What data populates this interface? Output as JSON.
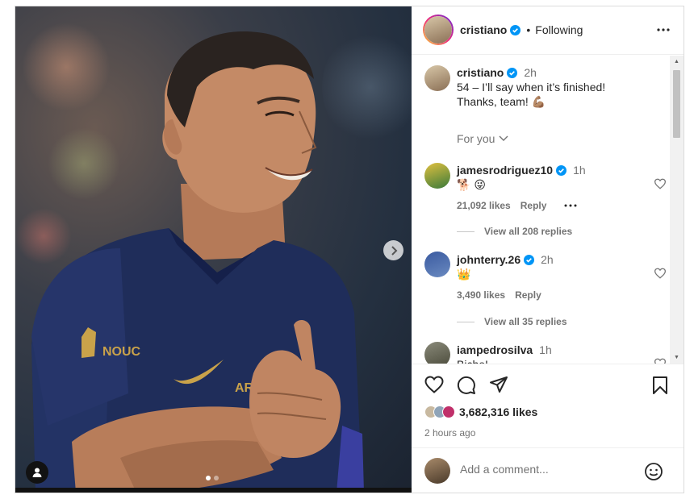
{
  "post": {
    "author": "cristiano",
    "follow_status": "Following",
    "separator": "•",
    "caption_line1": "54 – I’ll say when it’s finished!",
    "caption_line2": "Thanks, team! 💪🏽",
    "caption_time": "2h",
    "translation_label": "For you",
    "likes": "3,682,316 likes",
    "posted": "2 hours ago",
    "carousel": {
      "total": 2,
      "current": 1
    }
  },
  "comments": [
    {
      "user": "jamesrodriguez10",
      "verified": true,
      "time": "1h",
      "text": "🐕 😜",
      "likes": "21,092 likes",
      "reply": "Reply",
      "view_replies": "View all 208 replies"
    },
    {
      "user": "johnterry.26",
      "verified": true,
      "time": "2h",
      "text": "👑",
      "likes": "3,490 likes",
      "reply": "Reply",
      "view_replies": "View all 35 replies"
    },
    {
      "user": "iampedrosilva",
      "verified": false,
      "time": "1h",
      "text": "Bicho!"
    }
  ],
  "comment_box": {
    "placeholder": "Add a comment..."
  },
  "colors": {
    "verified": "#0095f6",
    "text": "#262626",
    "muted": "#737373",
    "border": "#dbdbdb"
  },
  "icons": [
    "verified-icon",
    "more-icon",
    "heart-icon",
    "comment-icon",
    "share-icon",
    "bookmark-icon",
    "emoji-icon",
    "chevron-right-icon",
    "user-tag-icon",
    "chevron-down-icon"
  ]
}
